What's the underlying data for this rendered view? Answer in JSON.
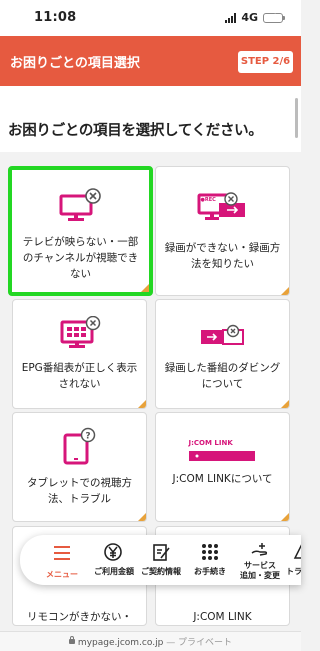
{
  "status_bar": {
    "time": "11:08",
    "network": "4G",
    "battery_charging": true
  },
  "header": {
    "title": "お困りごとの項目選択",
    "step": "STEP 2/6"
  },
  "page": {
    "heading": "お困りごとの項目を選択してください。"
  },
  "options": [
    {
      "label": "テレビが映らない・一部のチャンネルが視聴できない",
      "icon": "tv-error-icon",
      "selected": true
    },
    {
      "label": "録画ができない・録画方法を知りたい",
      "icon": "recorder-icon",
      "selected": false
    },
    {
      "label": "EPG番組表が正しく表示されない",
      "icon": "epg-error-icon",
      "selected": false
    },
    {
      "label": "録画した番組のダビングについて",
      "icon": "dubbing-icon",
      "selected": false
    },
    {
      "label": "タブレットでの視聴方法、トラブル",
      "icon": "tablet-help-icon",
      "selected": false
    },
    {
      "label": "J:COM LINKについて",
      "icon": "jcom-link-icon",
      "selected": false
    }
  ],
  "partial_options": [
    {
      "label": "リモコンがきかない・"
    },
    {
      "label": "J:COM LINK"
    }
  ],
  "jcom_link_device_text": "J:COM LINK",
  "rec_text": "●REC",
  "bottom_nav": [
    {
      "label": "メニュー",
      "icon": "hamburger-menu-icon",
      "active": true
    },
    {
      "label": "ご利用金額",
      "icon": "yen-icon",
      "active": false
    },
    {
      "label": "ご契約情報",
      "icon": "contract-edit-icon",
      "active": false
    },
    {
      "label": "お手続き",
      "icon": "grid-dots-icon",
      "active": false
    },
    {
      "label": "サービス\n追加・変更",
      "label_line1": "サービス",
      "label_line2": "追加・変更",
      "icon": "hand-plus-icon",
      "active": false
    },
    {
      "label": "トラ",
      "icon": "trouble-icon",
      "active": false
    }
  ],
  "url_bar": {
    "domain": "mypage.jcom.co.jp",
    "suffix": "— プライベート"
  },
  "colors": {
    "brand": "#e65a40",
    "icon_magenta": "#d6157a",
    "selected_border": "#23d723",
    "corner_accent": "#e8a23a"
  }
}
